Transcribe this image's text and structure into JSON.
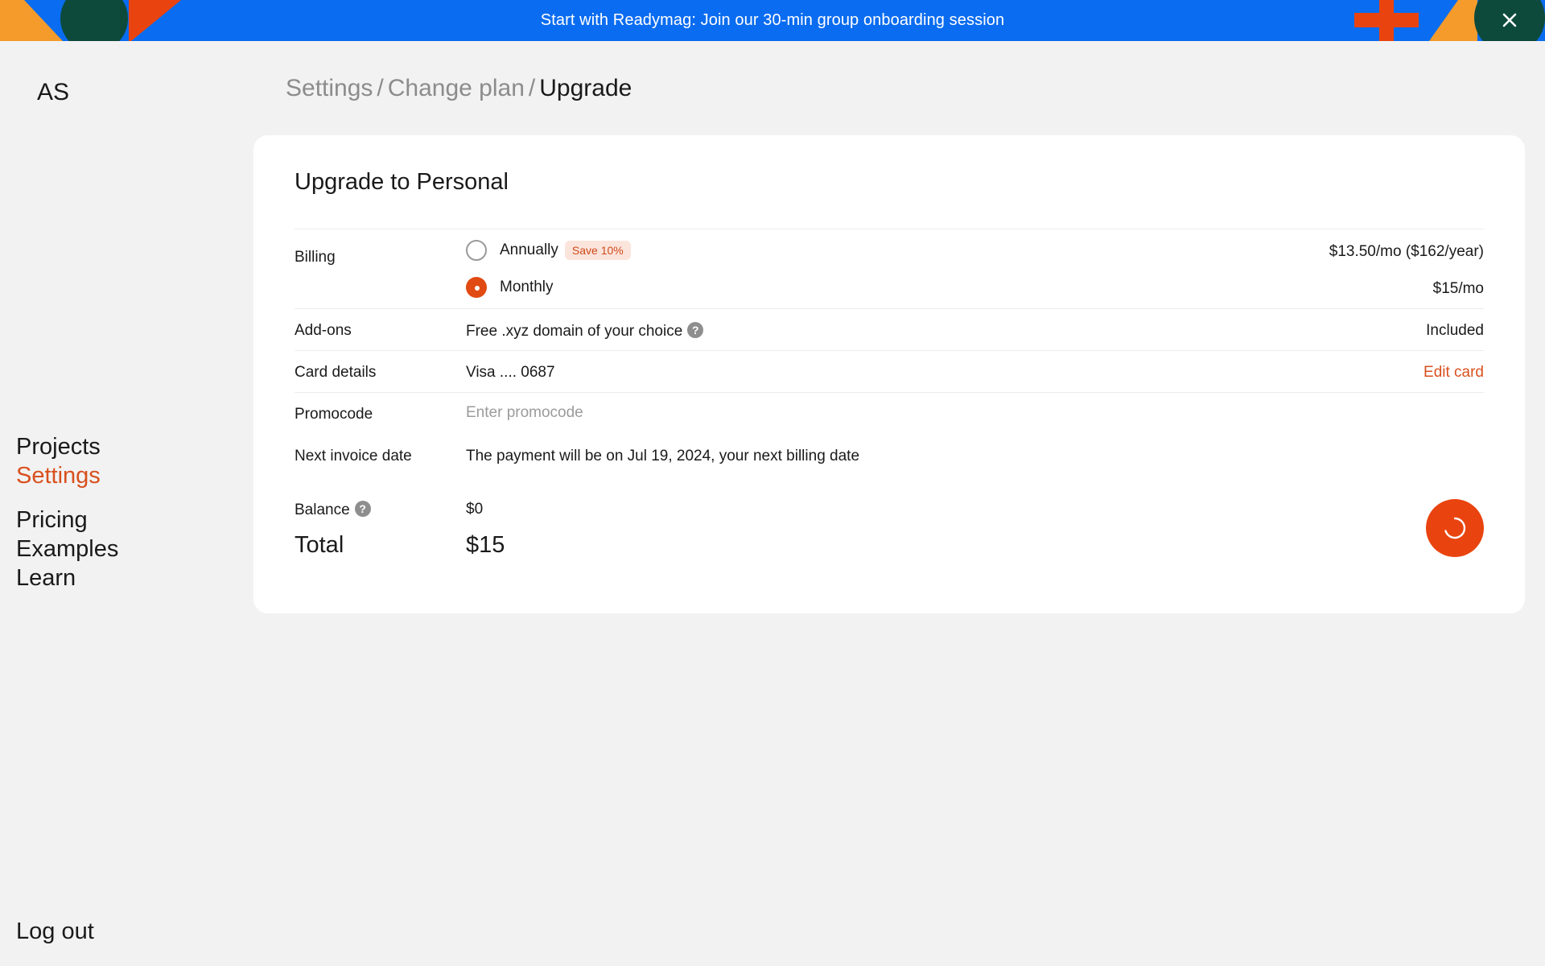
{
  "banner": {
    "text": "Start with Readymag: Join our 30-min group onboarding session",
    "close_icon": "close-icon"
  },
  "sidebar": {
    "user_initials": "AS",
    "nav_primary": [
      {
        "label": "Projects",
        "active": false
      },
      {
        "label": "Settings",
        "active": true
      }
    ],
    "nav_secondary": [
      {
        "label": "Pricing"
      },
      {
        "label": "Examples"
      },
      {
        "label": "Learn"
      }
    ],
    "logout_label": "Log out"
  },
  "breadcrumb": {
    "items": [
      "Settings",
      "Change plan"
    ],
    "separator": "/",
    "current": "Upgrade"
  },
  "upgrade": {
    "title": "Upgrade to Personal",
    "billing": {
      "label": "Billing",
      "options": [
        {
          "label": "Annually",
          "badge": "Save 10%",
          "price": "$13.50/mo ($162/year)",
          "selected": false
        },
        {
          "label": "Monthly",
          "price": "$15/mo",
          "selected": true
        }
      ]
    },
    "addons": {
      "label": "Add-ons",
      "value": "Free .xyz domain of your choice",
      "status": "Included",
      "help_icon": "help-icon"
    },
    "card": {
      "label": "Card details",
      "value": "Visa .... 0687",
      "action": "Edit card"
    },
    "promocode": {
      "label": "Promocode",
      "placeholder": "Enter promocode",
      "value": ""
    },
    "invoice": {
      "label": "Next invoice date",
      "value": "The payment will be on Jul 19, 2024, your next billing date"
    },
    "balance": {
      "label": "Balance",
      "value": "$0",
      "help_icon": "help-icon"
    },
    "total": {
      "label": "Total",
      "value": "$15"
    },
    "submit_icon": "loading-spinner-icon"
  },
  "colors": {
    "accent": "#e9440f",
    "accent_text": "#d9501e",
    "banner_bg": "#0a6cf0",
    "page_bg": "#f2f2f2",
    "card_bg": "#ffffff"
  }
}
